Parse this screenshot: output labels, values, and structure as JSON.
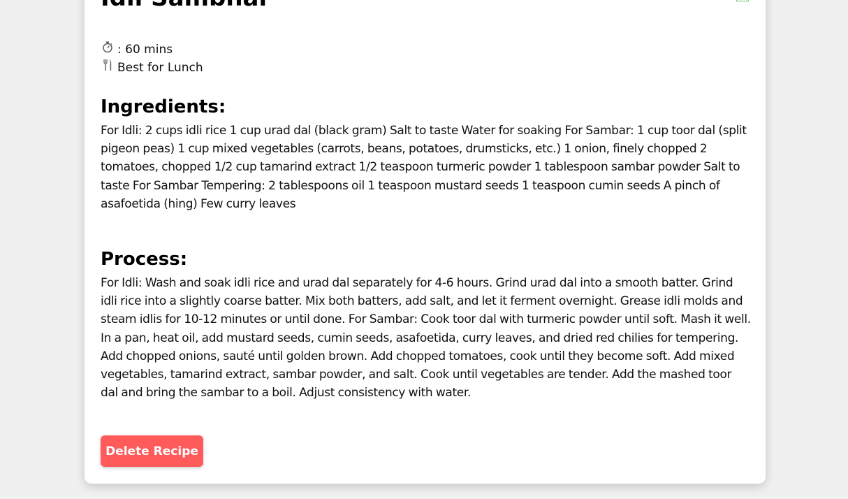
{
  "recipe": {
    "title": "Idli Sambhar",
    "time_text": ": 60 mins",
    "best_for_text": "Best for Lunch",
    "icons": {
      "time": "stopwatch-icon",
      "meal": "fork-knife-icon"
    }
  },
  "ingredients": {
    "heading": "Ingredients:",
    "text": "For Idli: 2 cups idli rice 1 cup urad dal (black gram) Salt to taste Water for soaking For Sambar: 1 cup toor dal (split pigeon peas) 1 cup mixed vegetables (carrots, beans, potatoes, drumsticks, etc.) 1 onion, finely chopped 2 tomatoes, chopped 1/2 cup tamarind extract 1/2 teaspoon turmeric powder 1 tablespoon sambar powder Salt to taste For Sambar Tempering: 2 tablespoons oil 1 teaspoon mustard seeds 1 teaspoon cumin seeds A pinch of asafoetida (hing) Few curry leaves"
  },
  "process": {
    "heading": "Process:",
    "text": "For Idli: Wash and soak idli rice and urad dal separately for 4-6 hours. Grind urad dal into a smooth batter. Grind idli rice into a slightly coarse batter. Mix both batters, add salt, and let it ferment overnight. Grease idli molds and steam idlis for 10-12 minutes or until done. For Sambar: Cook toor dal with turmeric powder until soft. Mash it well. In a pan, heat oil, add mustard seeds, cumin seeds, asafoetida, curry leaves, and dried red chilies for tempering. Add chopped onions, sauté until golden brown. Add chopped tomatoes, cook until they become soft. Add mixed vegetables, tamarind extract, sambar powder, and salt. Cook until vegetables are tender. Add the mashed toor dal and bring the sambar to a boil. Adjust consistency with water."
  },
  "actions": {
    "delete_label": "Delete Recipe"
  },
  "colors": {
    "page_background": "#f0f0f0",
    "card_background": "#ffffff",
    "delete_button": "#ff5b5b"
  }
}
